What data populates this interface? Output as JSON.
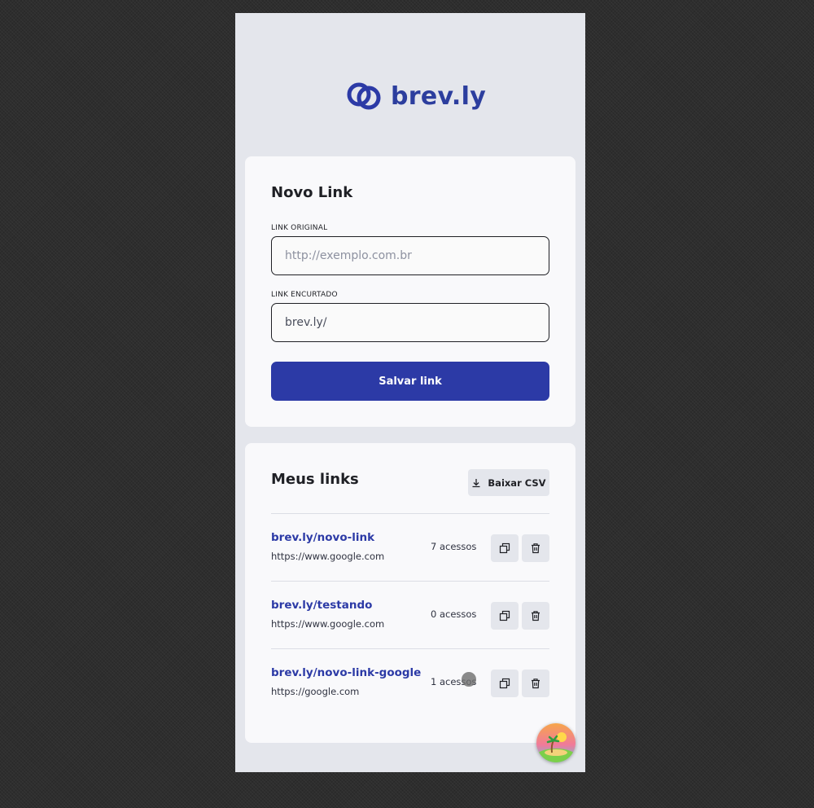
{
  "brand": {
    "name": "brev.ly",
    "color": "#2c3aa6"
  },
  "new_link": {
    "title": "Novo Link",
    "original_label": "LINK ORIGINAL",
    "original_placeholder": "http://exemplo.com.br",
    "short_label": "LINK ENCURTADO",
    "short_prefix": "brev.ly/",
    "save_label": "Salvar link"
  },
  "my_links": {
    "title": "Meus links",
    "csv_label": "Baixar CSV",
    "items": [
      {
        "short": "brev.ly/novo-link",
        "original": "https://www.google.com",
        "accesses": "7 acessos"
      },
      {
        "short": "brev.ly/testando",
        "original": "https://www.google.com",
        "accesses": "0 acessos"
      },
      {
        "short": "brev.ly/novo-link-google",
        "original": "https://google.com",
        "accesses": "1 acessos"
      }
    ]
  },
  "icons": {
    "download": "download-icon",
    "copy": "copy-icon",
    "delete": "trash-icon",
    "fab": "beach-avatar-icon"
  }
}
